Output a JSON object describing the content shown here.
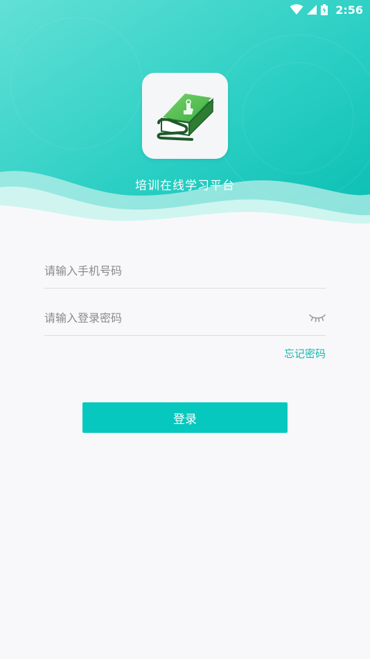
{
  "status_bar": {
    "time": "2:56",
    "icons": [
      "wifi-icon",
      "signal-icon",
      "battery-icon"
    ]
  },
  "app": {
    "title": "培训在线学习平台",
    "logo_icon": "book-icon"
  },
  "form": {
    "phone_placeholder": "请输入手机号码",
    "phone_value": "",
    "password_placeholder": "请输入登录密码",
    "password_value": "",
    "password_toggle_icon": "eye-closed-icon",
    "forgot_label": "忘记密码",
    "login_label": "登录"
  },
  "colors": {
    "accent": "#06c8be",
    "header_light": "#5fe0d6",
    "header_dark": "#0cbdb2",
    "link": "#12b9b0",
    "background": "#f8f8fa"
  }
}
